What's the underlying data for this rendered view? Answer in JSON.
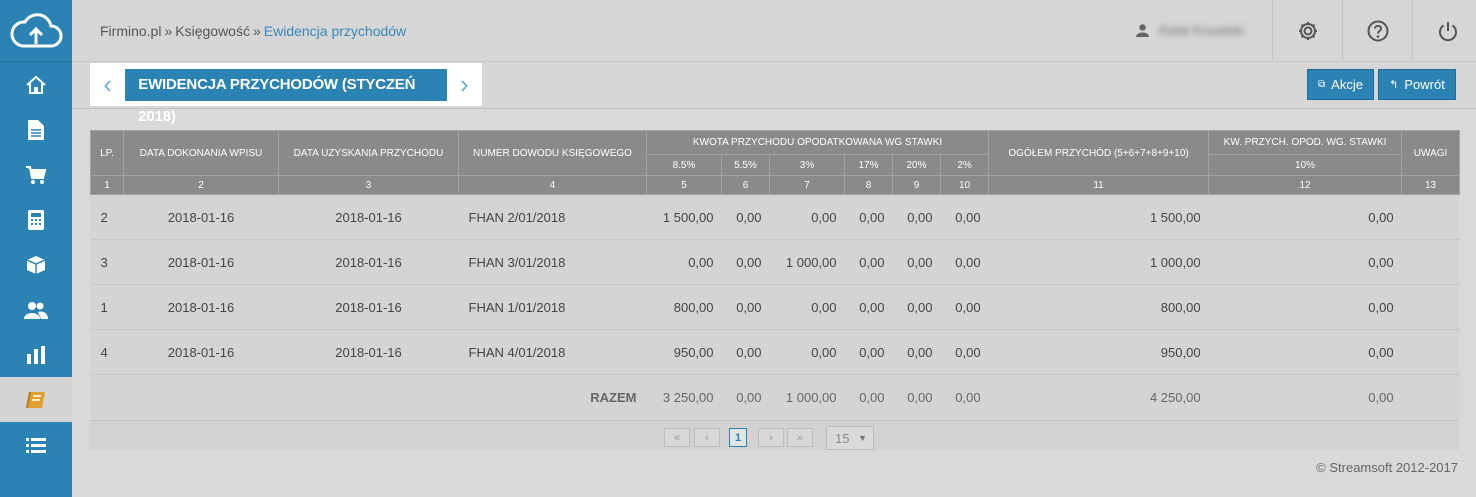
{
  "breadcrumb": {
    "item1": "Firmino.pl",
    "sep": "»",
    "item2": "Księgowość",
    "item3": "Ewidencja przychodów"
  },
  "user": {
    "name": "Rafał Kowalski"
  },
  "title": "EWIDENCJA PRZYCHODÓW (STYCZEŃ 2018)",
  "toolbar": {
    "actions_label": "Akcje",
    "back_label": "Powrót"
  },
  "table": {
    "headers": {
      "lp": "LP.",
      "data_wpisu": "DATA DOKONANIA WPISU",
      "data_przychodu": "DATA UZYSKANIA PRZYCHODU",
      "numer_dowodu": "NUMER DOWODU KSIĘGOWEGO",
      "kwota_group": "KWOTA PRZYCHODU OPODATKOWANA WG STAWKI",
      "rates": [
        "8.5%",
        "5.5%",
        "3%",
        "17%",
        "20%",
        "2%"
      ],
      "ogolem": "OGÓŁEM PRZYCHÓD (5+6+7+8+9+10)",
      "kw_group": "KW. PRZYCH. OPOD. WG. STAWKI",
      "kw_rate": "10%",
      "uwagi": "UWAGI"
    },
    "col_numbers": [
      "1",
      "2",
      "3",
      "4",
      "5",
      "6",
      "7",
      "8",
      "9",
      "10",
      "11",
      "12",
      "13"
    ],
    "rows": [
      {
        "lp": "2",
        "data_wpisu": "2018-01-16",
        "data_przychodu": "2018-01-16",
        "numer": "FHAN 2/01/2018",
        "c5": "1 500,00",
        "c6": "0,00",
        "c7": "0,00",
        "c8": "0,00",
        "c9": "0,00",
        "c10": "0,00",
        "c11": "1 500,00",
        "c12": "0,00",
        "c13": ""
      },
      {
        "lp": "3",
        "data_wpisu": "2018-01-16",
        "data_przychodu": "2018-01-16",
        "numer": "FHAN 3/01/2018",
        "c5": "0,00",
        "c6": "0,00",
        "c7": "1 000,00",
        "c8": "0,00",
        "c9": "0,00",
        "c10": "0,00",
        "c11": "1 000,00",
        "c12": "0,00",
        "c13": ""
      },
      {
        "lp": "1",
        "data_wpisu": "2018-01-16",
        "data_przychodu": "2018-01-16",
        "numer": "FHAN 1/01/2018",
        "c5": "800,00",
        "c6": "0,00",
        "c7": "0,00",
        "c8": "0,00",
        "c9": "0,00",
        "c10": "0,00",
        "c11": "800,00",
        "c12": "0,00",
        "c13": ""
      },
      {
        "lp": "4",
        "data_wpisu": "2018-01-16",
        "data_przychodu": "2018-01-16",
        "numer": "FHAN 4/01/2018",
        "c5": "950,00",
        "c6": "0,00",
        "c7": "0,00",
        "c8": "0,00",
        "c9": "0,00",
        "c10": "0,00",
        "c11": "950,00",
        "c12": "0,00",
        "c13": ""
      }
    ],
    "totals": {
      "label": "RAZEM",
      "c5": "3 250,00",
      "c6": "0,00",
      "c7": "1 000,00",
      "c8": "0,00",
      "c9": "0,00",
      "c10": "0,00",
      "c11": "4 250,00",
      "c12": "0,00"
    }
  },
  "pagination": {
    "current_page": "1",
    "page_size": "15"
  },
  "footer": {
    "copyright": "© Streamsoft 2012-2017"
  },
  "colors": {
    "primary": "#2b83b4",
    "header_gray": "#8a8a8a",
    "background": "#d4d4d4",
    "active_nav_icon": "#e0a030"
  }
}
